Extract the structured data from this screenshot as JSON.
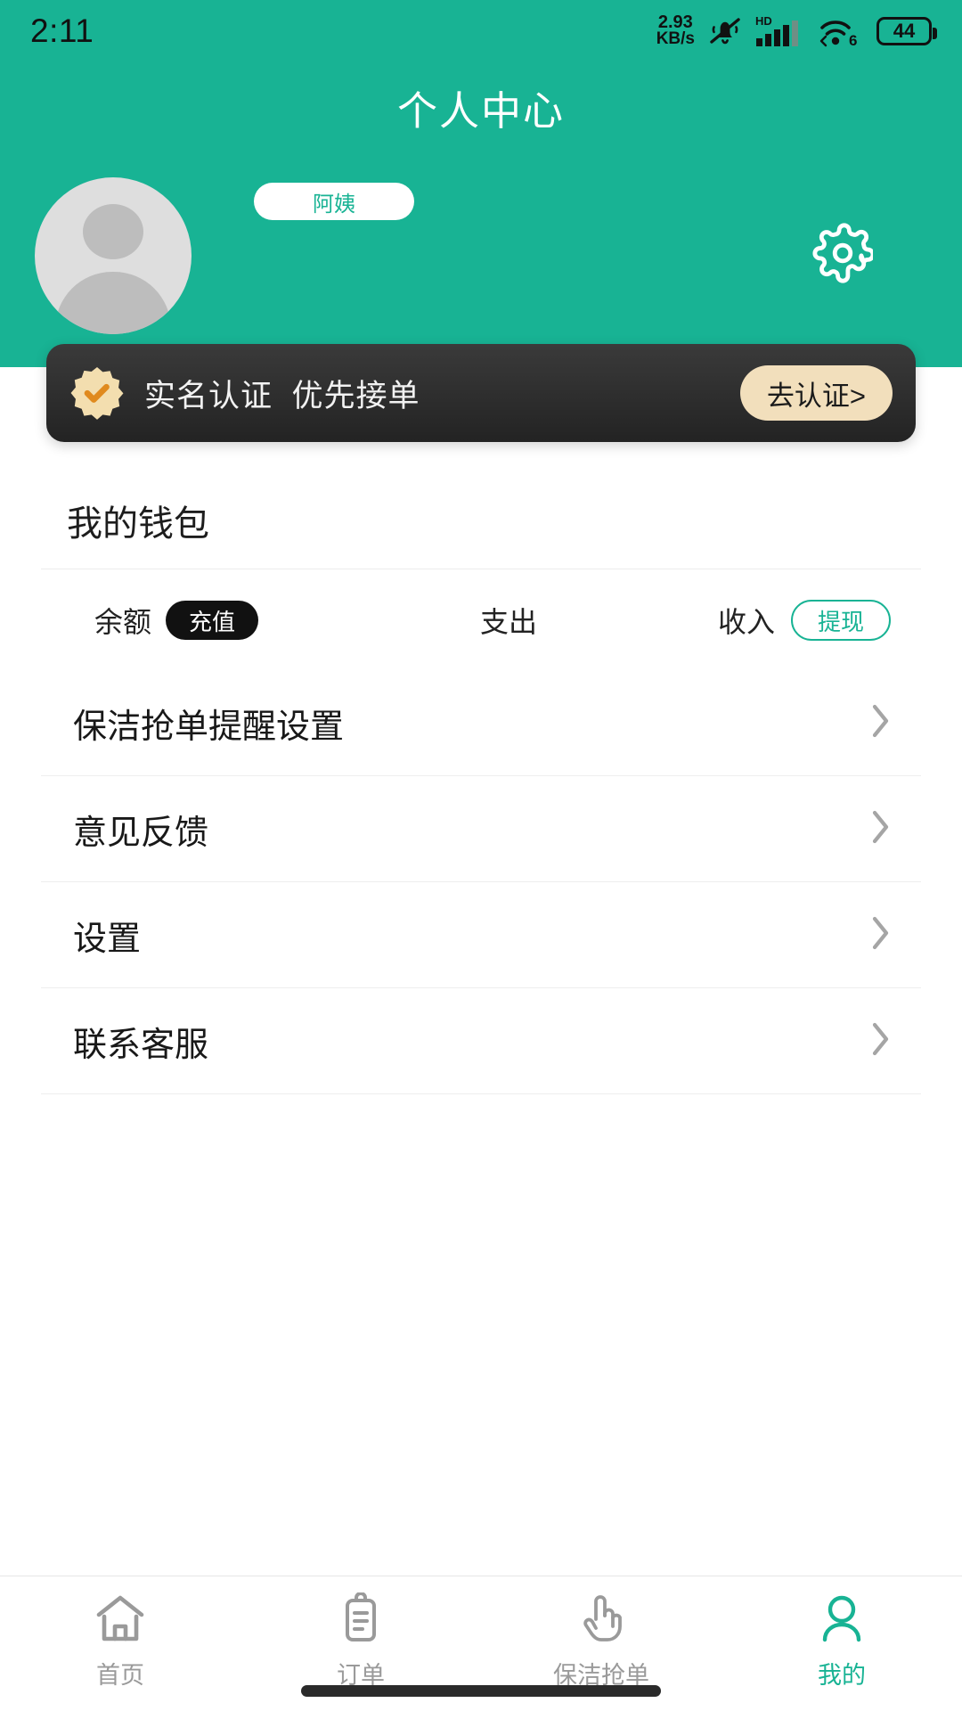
{
  "status_bar": {
    "clock": "2:11",
    "net_speed_value": "2.93",
    "net_speed_unit": "KB/s",
    "mute_icon": "bell-muted-icon",
    "hd_label": "HD",
    "signal_icon": "cellular-signal-icon",
    "wifi_icon": "wifi-icon",
    "wifi_generation": "6",
    "battery_level": "44"
  },
  "header": {
    "title": "个人中心",
    "role_badge": "阿姨",
    "settings_icon": "gear-icon",
    "avatar_icon": "avatar-placeholder-icon",
    "background_color": "#18B394"
  },
  "verify_banner": {
    "badge_icon": "verified-badge-icon",
    "text": "实名认证  优先接单",
    "button_label": "去认证>",
    "background_color": "#2e2e2e",
    "button_color": "#F2DFBC"
  },
  "wallet": {
    "title": "我的钱包",
    "cells": [
      {
        "label": "余额",
        "action": "充值",
        "action_style": "dark-pill"
      },
      {
        "label": "支出",
        "action": "",
        "action_style": "none"
      },
      {
        "label": "收入",
        "action": "提现",
        "action_style": "outline-pill"
      }
    ]
  },
  "menu": {
    "items": [
      {
        "label": "保洁抢单提醒设置",
        "chevron": "chevron-right-icon"
      },
      {
        "label": "意见反馈",
        "chevron": "chevron-right-icon"
      },
      {
        "label": "设置",
        "chevron": "chevron-right-icon"
      },
      {
        "label": "联系客服",
        "chevron": "chevron-right-icon"
      }
    ]
  },
  "bottom_nav": {
    "active_index": 3,
    "active_color": "#18B394",
    "inactive_color": "#9A9A9A",
    "items": [
      {
        "label": "首页",
        "icon": "home-icon"
      },
      {
        "label": "订单",
        "icon": "clipboard-icon"
      },
      {
        "label": "保洁抢单",
        "icon": "tap-hand-icon"
      },
      {
        "label": "我的",
        "icon": "person-icon"
      }
    ]
  }
}
